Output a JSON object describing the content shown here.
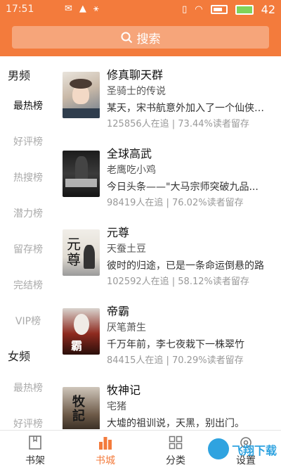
{
  "status": {
    "time": "17:51",
    "watermark": "飞翔下载 www.FXXZ.com",
    "battery": "42"
  },
  "search": {
    "placeholder": "搜索"
  },
  "sidebar": {
    "male_title": "男频",
    "male_items": [
      "最热榜",
      "好评榜",
      "热搜榜",
      "潜力榜",
      "留存榜",
      "完结榜",
      "VIP榜"
    ],
    "female_title": "女频",
    "female_items": [
      "最热榜",
      "好评榜"
    ]
  },
  "books": [
    {
      "title": "修真聊天群",
      "author": "圣骑士的传说",
      "desc": "某天，宋书航意外加入了一个仙侠中二病资深患者的交流群",
      "stats": "125856人在追 | 73.44%读者留存"
    },
    {
      "title": "全球高武",
      "author": "老鹰吃小鸡",
      "desc": "今日头条——\"大马宗师突破九品...",
      "stats": "98419人在追 | 76.02%读者留存"
    },
    {
      "title": "元尊",
      "author": "天蚕土豆",
      "desc": "彼时的归途，已是一条命运倒悬的路",
      "stats": "102592人在追 | 58.12%读者留存"
    },
    {
      "title": "帝霸",
      "author": "厌笔萧生",
      "desc": "千万年前，李七夜栽下一株翠竹",
      "stats": "84415人在追 | 70.29%读者留存"
    },
    {
      "title": "牧神记",
      "author": "宅猪",
      "desc": "大墟的祖训说，天黑，别出门。",
      "stats": ""
    }
  ],
  "tabs": [
    {
      "label": "书架",
      "icon": "bookshelf-icon"
    },
    {
      "label": "书城",
      "icon": "bookstore-icon"
    },
    {
      "label": "分类",
      "icon": "category-icon"
    },
    {
      "label": "设置",
      "icon": "settings-icon"
    }
  ],
  "watermark_badge": "飞翔下载",
  "colors": {
    "accent": "#f37b3c",
    "search_bg": "#f6a57a"
  }
}
